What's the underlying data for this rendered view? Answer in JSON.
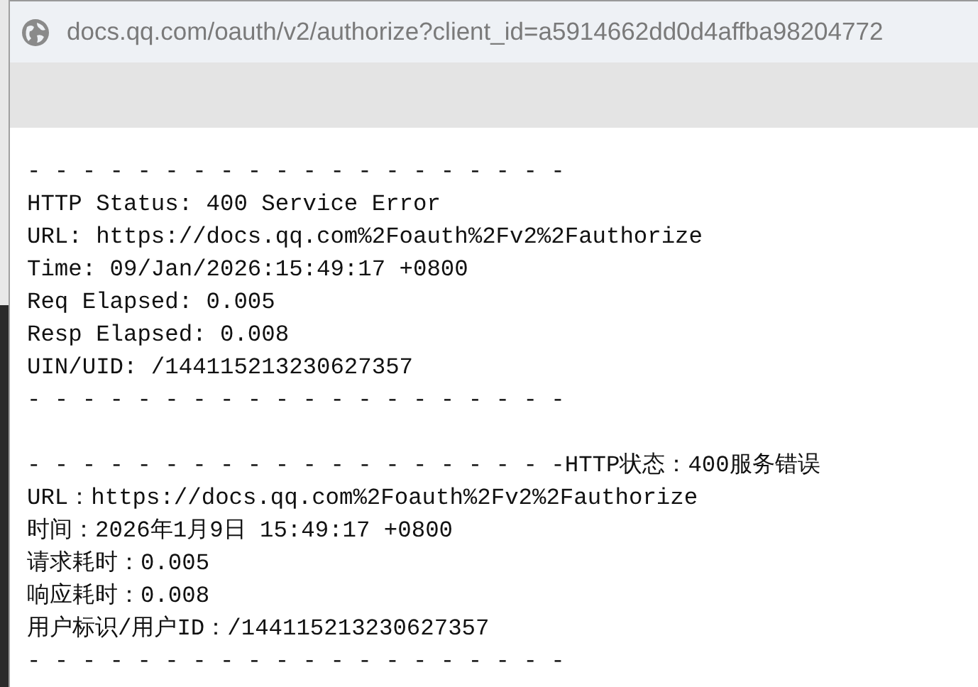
{
  "address_bar": {
    "url": "docs.qq.com/oauth/v2/authorize?client_id=a5914662dd0d4affba98204772"
  },
  "blocks": [
    {
      "lines": [
        "- - - - - - - - - - - - - - - - - - - -",
        "HTTP Status: 400 Service Error",
        "URL: https://docs.qq.com%2Foauth%2Fv2%2Fauthorize",
        "Time: 09/Jan/2026:15:49:17 +0800",
        "Req Elapsed: 0.005",
        "Resp Elapsed: 0.008",
        "UIN/UID: /144115213230627357",
        "- - - - - - - - - - - - - - - - - - - -"
      ]
    },
    {
      "lines": [
        "- - - - - - - - - - - - - - - - - - - -HTTP状态：400服务错误",
        "URL：https://docs.qq.com%2Foauth%2Fv2%2Fauthorize",
        "时间：2026年1月9日 15:49:17 +0800",
        "请求耗时：0.005",
        "响应耗时：0.008",
        "用户标识/用户ID：/144115213230627357",
        "- - - - - - - - - - - - - - - - - - - -"
      ]
    }
  ]
}
